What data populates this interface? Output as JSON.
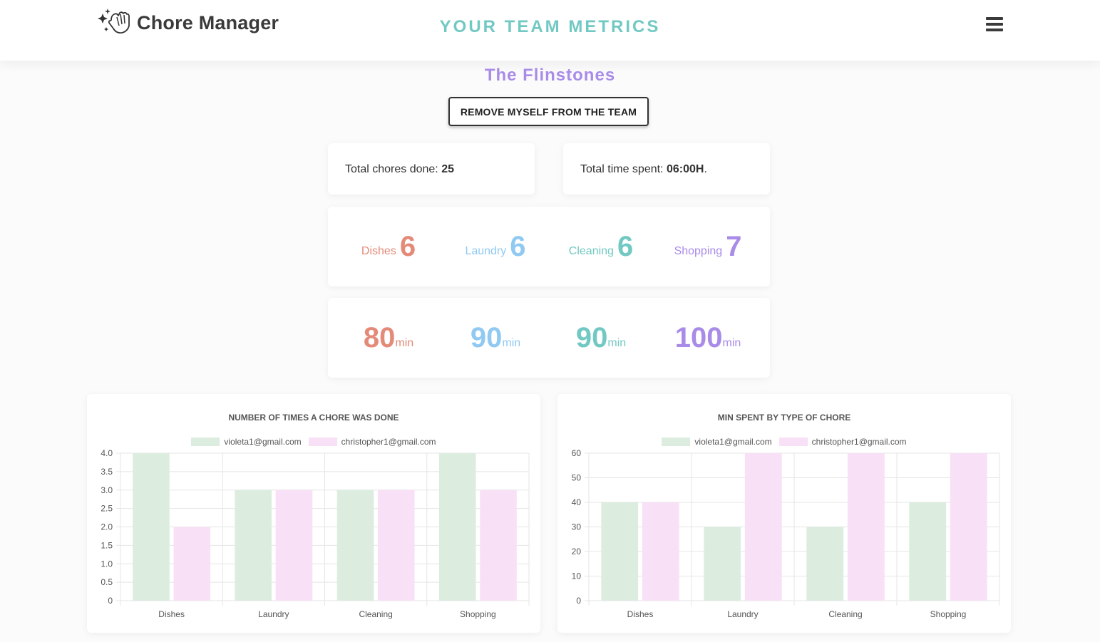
{
  "header": {
    "app_title": "Chore Manager",
    "page_title": "YOUR TEAM METRICS",
    "logo_icon": "sparkle-hand-icon",
    "menu_icon": "hamburger-menu-icon"
  },
  "team": {
    "name": "The Flinstones",
    "remove_button": "REMOVE MYSELF FROM THE TEAM"
  },
  "stats": {
    "chores_label": "Total chores done: ",
    "chores_value": "25",
    "time_label": "Total time spent: ",
    "time_value": "06:00H",
    "time_suffix": "."
  },
  "chore_counts": [
    {
      "label": "Dishes",
      "value": "6",
      "color": "#e48a79"
    },
    {
      "label": "Laundry",
      "value": "6",
      "color": "#90c9f2"
    },
    {
      "label": "Cleaning",
      "value": "6",
      "color": "#72c9c3"
    },
    {
      "label": "Shopping",
      "value": "7",
      "color": "#a98be8"
    }
  ],
  "chore_times": [
    {
      "value": "80",
      "unit": "min"
    },
    {
      "value": "90",
      "unit": "min"
    },
    {
      "value": "90",
      "unit": "min"
    },
    {
      "value": "100",
      "unit": "min"
    }
  ],
  "chart_data": [
    {
      "type": "bar",
      "title": "NUMBER OF TIMES A CHORE WAS DONE",
      "categories": [
        "Dishes",
        "Laundry",
        "Cleaning",
        "Shopping"
      ],
      "series": [
        {
          "name": "violeta1@gmail.com",
          "values": [
            4,
            3,
            3,
            4
          ],
          "color": "#dcede0"
        },
        {
          "name": "christopher1@gmail.com",
          "values": [
            2,
            3,
            3,
            3
          ],
          "color": "#f8e1f6"
        }
      ],
      "ylim": [
        0,
        4
      ],
      "yticks": [
        "4.0",
        "3.5",
        "3.0",
        "2.5",
        "2.0",
        "1.5",
        "1.0",
        "0.5",
        "0"
      ],
      "legend": "top",
      "grid": true
    },
    {
      "type": "bar",
      "title": "MIN SPENT BY TYPE OF CHORE",
      "categories": [
        "Dishes",
        "Laundry",
        "Cleaning",
        "Shopping"
      ],
      "series": [
        {
          "name": "violeta1@gmail.com",
          "values": [
            40,
            30,
            30,
            40
          ],
          "color": "#dcede0"
        },
        {
          "name": "christopher1@gmail.com",
          "values": [
            40,
            60,
            60,
            60
          ],
          "color": "#f8e1f6"
        }
      ],
      "ylim": [
        0,
        60
      ],
      "yticks": [
        "60",
        "50",
        "40",
        "30",
        "20",
        "10",
        "0"
      ],
      "legend": "top",
      "grid": true
    }
  ]
}
